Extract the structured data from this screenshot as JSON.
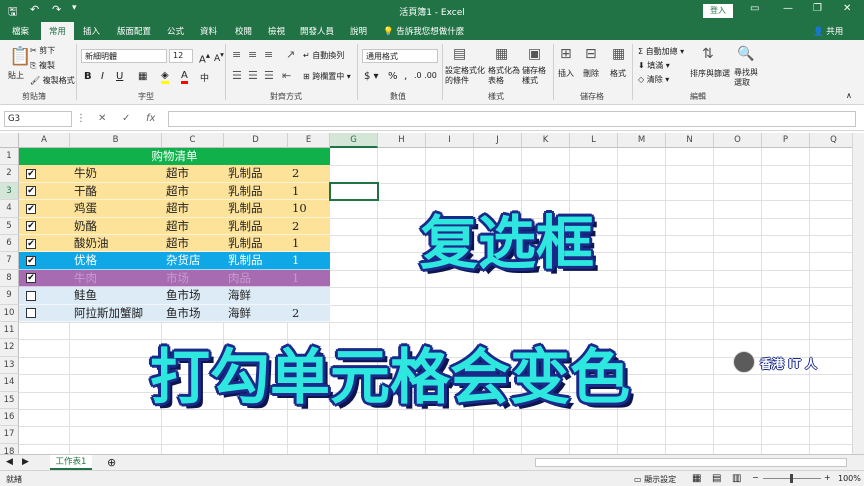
{
  "window": {
    "title": "活頁簿1 - Excel",
    "login": "登入",
    "minimize_icon": "—",
    "restore_icon": "❐",
    "close_icon": "✕"
  },
  "tabs": [
    "檔案",
    "常用",
    "插入",
    "版面配置",
    "公式",
    "資料",
    "校閱",
    "檢視",
    "開發人員",
    "說明"
  ],
  "tell_me": "告訴我您想做什麼",
  "share": "共用",
  "ribbon": {
    "clipboard": {
      "label": "剪貼簿",
      "paste": "貼上",
      "cut": "剪下",
      "copy": "複製",
      "format_painter": "複製格式"
    },
    "font": {
      "label": "字型",
      "name": "新細明體",
      "size": "12"
    },
    "alignment": {
      "label": "對齊方式",
      "wrap": "自動換列",
      "merge": "跨欄置中"
    },
    "number": {
      "label": "數值",
      "format": "通用格式"
    },
    "styles": {
      "label": "樣式",
      "conditional": "設定格式化的條件",
      "as_table": "格式化為表格",
      "cell_styles": "儲存格樣式"
    },
    "cells": {
      "label": "儲存格",
      "insert": "插入",
      "delete": "刪除",
      "format": "格式"
    },
    "editing": {
      "label": "編輯",
      "autosum": "自動加總",
      "fill": "填滿",
      "clear": "清除",
      "sort": "排序與篩選",
      "find": "尋找與選取"
    }
  },
  "formula_bar": {
    "name_box": "G3",
    "fx": "fx",
    "cancel": "✕",
    "enter": "✓"
  },
  "columns": [
    "A",
    "B",
    "C",
    "D",
    "E",
    "G",
    "H",
    "I",
    "J",
    "K",
    "L",
    "M",
    "N",
    "O",
    "P",
    "Q"
  ],
  "row_numbers": [
    "1",
    "2",
    "3",
    "4",
    "5",
    "6",
    "7",
    "8",
    "9",
    "10",
    "11",
    "12",
    "13",
    "14",
    "15",
    "16",
    "17",
    "18"
  ],
  "sheet": {
    "title": "购物清单",
    "rows": [
      {
        "checked": true,
        "item": "牛奶",
        "store": "超市",
        "category": "乳制品",
        "qty": "2",
        "color": "#fde29a"
      },
      {
        "checked": true,
        "item": "干酪",
        "store": "超市",
        "category": "乳制品",
        "qty": "1",
        "color": "#fde29a"
      },
      {
        "checked": true,
        "item": "鸡蛋",
        "store": "超市",
        "category": "乳制品",
        "qty": "10",
        "color": "#fde29a"
      },
      {
        "checked": true,
        "item": "奶酪",
        "store": "超市",
        "category": "乳制品",
        "qty": "2",
        "color": "#fde29a"
      },
      {
        "checked": true,
        "item": "酸奶油",
        "store": "超市",
        "category": "乳制品",
        "qty": "1",
        "color": "#fde29a"
      },
      {
        "checked": true,
        "item": "优格",
        "store": "杂货店",
        "category": "乳制品",
        "qty": "1",
        "color": "#0fa7e6"
      },
      {
        "checked": true,
        "item": "牛肉",
        "store": "市场",
        "category": "肉品",
        "qty": "1",
        "color": "#a66bb0"
      },
      {
        "checked": false,
        "item": "鲑鱼",
        "store": "鱼市场",
        "category": "海鲜",
        "qty": "",
        "color": "#ddebf7"
      },
      {
        "checked": false,
        "item": "阿拉斯加蟹脚",
        "store": "鱼市场",
        "category": "海鲜",
        "qty": "2",
        "color": "#ddebf7"
      }
    ],
    "header_color": "#10b04b"
  },
  "captions": {
    "main": "复选框",
    "sub": "打勾单元格会变色",
    "badge": "香港 IT 人"
  },
  "sheet_tab": "工作表1",
  "status": {
    "ready": "就緒",
    "display_settings": "顯示設定",
    "zoom": "100%"
  }
}
